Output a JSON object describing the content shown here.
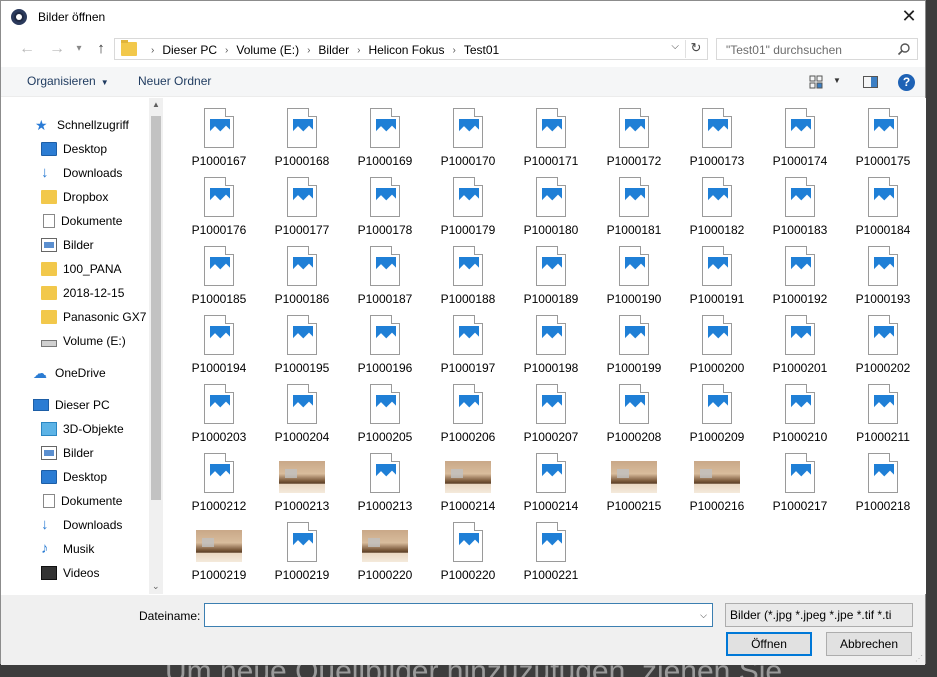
{
  "window": {
    "title": "Bilder öffnen",
    "close_glyph": "✕"
  },
  "nav": {
    "back_glyph": "←",
    "forward_glyph": "→",
    "up_glyph": "↑",
    "breadcrumbs": [
      "Dieser PC",
      "Volume (E:)",
      "Bilder",
      "Helicon Fokus",
      "Test01"
    ],
    "search_placeholder": "\"Test01\" durchsuchen"
  },
  "toolbar": {
    "organize_label": "Organisieren",
    "new_folder_label": "Neuer Ordner",
    "help_label": "?"
  },
  "sidebar": {
    "items": [
      {
        "label": "Schnellzugriff",
        "icon": "star-icon",
        "pinned": false
      },
      {
        "label": "Desktop",
        "icon": "desktop-icon",
        "pinned": true
      },
      {
        "label": "Downloads",
        "icon": "download-icon",
        "pinned": true
      },
      {
        "label": "Dropbox",
        "icon": "folder-icon",
        "pinned": true
      },
      {
        "label": "Dokumente",
        "icon": "document-icon",
        "pinned": true
      },
      {
        "label": "Bilder",
        "icon": "pictures-icon",
        "pinned": true
      },
      {
        "label": "100_PANA",
        "icon": "folder-icon",
        "pinned": false
      },
      {
        "label": "2018-12-15",
        "icon": "folder-icon",
        "pinned": false
      },
      {
        "label": "Panasonic GX7",
        "icon": "folder-icon",
        "pinned": false
      },
      {
        "label": "Volume (E:)",
        "icon": "drive-icon",
        "pinned": false
      },
      {
        "label": "OneDrive",
        "icon": "cloud-icon",
        "pinned": false
      },
      {
        "label": "Dieser PC",
        "icon": "pc-icon",
        "pinned": false
      },
      {
        "label": "3D-Objekte",
        "icon": "cube-icon",
        "pinned": false
      },
      {
        "label": "Bilder",
        "icon": "pictures-icon",
        "pinned": false
      },
      {
        "label": "Desktop",
        "icon": "desktop-icon",
        "pinned": false
      },
      {
        "label": "Dokumente",
        "icon": "document-icon",
        "pinned": false
      },
      {
        "label": "Downloads",
        "icon": "download-icon",
        "pinned": false
      },
      {
        "label": "Musik",
        "icon": "music-icon",
        "pinned": false
      },
      {
        "label": "Videos",
        "icon": "video-icon",
        "pinned": false
      }
    ]
  },
  "files": [
    {
      "name": "P1000167",
      "kind": "doc"
    },
    {
      "name": "P1000168",
      "kind": "doc"
    },
    {
      "name": "P1000169",
      "kind": "doc"
    },
    {
      "name": "P1000170",
      "kind": "doc"
    },
    {
      "name": "P1000171",
      "kind": "doc"
    },
    {
      "name": "P1000172",
      "kind": "doc"
    },
    {
      "name": "P1000173",
      "kind": "doc"
    },
    {
      "name": "P1000174",
      "kind": "doc"
    },
    {
      "name": "P1000175",
      "kind": "doc"
    },
    {
      "name": "P1000176",
      "kind": "doc"
    },
    {
      "name": "P1000177",
      "kind": "doc"
    },
    {
      "name": "P1000178",
      "kind": "doc"
    },
    {
      "name": "P1000179",
      "kind": "doc"
    },
    {
      "name": "P1000180",
      "kind": "doc"
    },
    {
      "name": "P1000181",
      "kind": "doc"
    },
    {
      "name": "P1000182",
      "kind": "doc"
    },
    {
      "name": "P1000183",
      "kind": "doc"
    },
    {
      "name": "P1000184",
      "kind": "doc"
    },
    {
      "name": "P1000185",
      "kind": "doc"
    },
    {
      "name": "P1000186",
      "kind": "doc"
    },
    {
      "name": "P1000187",
      "kind": "doc"
    },
    {
      "name": "P1000188",
      "kind": "doc"
    },
    {
      "name": "P1000189",
      "kind": "doc"
    },
    {
      "name": "P1000190",
      "kind": "doc"
    },
    {
      "name": "P1000191",
      "kind": "doc"
    },
    {
      "name": "P1000192",
      "kind": "doc"
    },
    {
      "name": "P1000193",
      "kind": "doc"
    },
    {
      "name": "P1000194",
      "kind": "doc"
    },
    {
      "name": "P1000195",
      "kind": "doc"
    },
    {
      "name": "P1000196",
      "kind": "doc"
    },
    {
      "name": "P1000197",
      "kind": "doc"
    },
    {
      "name": "P1000198",
      "kind": "doc"
    },
    {
      "name": "P1000199",
      "kind": "doc"
    },
    {
      "name": "P1000200",
      "kind": "doc"
    },
    {
      "name": "P1000201",
      "kind": "doc"
    },
    {
      "name": "P1000202",
      "kind": "doc"
    },
    {
      "name": "P1000203",
      "kind": "doc"
    },
    {
      "name": "P1000204",
      "kind": "doc"
    },
    {
      "name": "P1000205",
      "kind": "doc"
    },
    {
      "name": "P1000206",
      "kind": "doc"
    },
    {
      "name": "P1000207",
      "kind": "doc"
    },
    {
      "name": "P1000208",
      "kind": "doc"
    },
    {
      "name": "P1000209",
      "kind": "doc"
    },
    {
      "name": "P1000210",
      "kind": "doc"
    },
    {
      "name": "P1000211",
      "kind": "doc"
    },
    {
      "name": "P1000212",
      "kind": "doc"
    },
    {
      "name": "P1000213",
      "kind": "photo"
    },
    {
      "name": "P1000213",
      "kind": "doc"
    },
    {
      "name": "P1000214",
      "kind": "photo"
    },
    {
      "name": "P1000214",
      "kind": "doc"
    },
    {
      "name": "P1000215",
      "kind": "photo"
    },
    {
      "name": "P1000216",
      "kind": "photo"
    },
    {
      "name": "P1000217",
      "kind": "doc"
    },
    {
      "name": "P1000218",
      "kind": "doc"
    },
    {
      "name": "P1000219",
      "kind": "photo"
    },
    {
      "name": "P1000219",
      "kind": "doc"
    },
    {
      "name": "P1000220",
      "kind": "photo"
    },
    {
      "name": "P1000220",
      "kind": "doc"
    },
    {
      "name": "P1000221",
      "kind": "doc"
    }
  ],
  "bottom": {
    "filename_label": "Dateiname:",
    "filename_value": "",
    "filter_value": "Bilder (*.jpg *.jpeg *.jpe *.tif *.ti",
    "open_label": "Öffnen",
    "cancel_label": "Abbrechen"
  },
  "background_text": "Um neue Quellbilder hinzuzufügen, ziehen Sie"
}
